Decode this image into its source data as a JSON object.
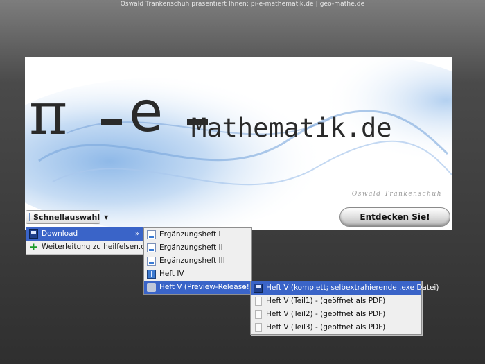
{
  "header": {
    "text": "Oswald Tränkenschuh präsentiert Ihnen: pi-e-mathematik.de | geo-mathe.de"
  },
  "banner": {
    "logo_pi": "π",
    "logo_e": "e",
    "logo_word": "Mathematik.de",
    "signature": "Oswald Tränkenschuh"
  },
  "toolbar": {
    "quick_select_label": "Schnellauswahl",
    "discover_label": "Entdecken Sie!"
  },
  "menu_main": {
    "items": [
      {
        "label": "Download",
        "icon": "floppy-icon",
        "submenu": true
      },
      {
        "label": "Weiterleitung zu heilfelsen.de",
        "icon": "plus-icon",
        "submenu": false
      }
    ]
  },
  "menu_download": {
    "items": [
      {
        "label": "Ergänzungsheft I",
        "icon": "page-icon"
      },
      {
        "label": "Ergänzungsheft II",
        "icon": "page-icon"
      },
      {
        "label": "Ergänzungsheft III",
        "icon": "page-icon"
      },
      {
        "label": "Heft IV",
        "icon": "book-icon"
      },
      {
        "label": "Heft V (Preview-Release!)",
        "icon": "download-icon",
        "submenu": true
      }
    ]
  },
  "menu_heft5": {
    "items": [
      {
        "label": "Heft V (komplett; selbextrahierende .exe Datei)",
        "icon": "floppy-icon"
      },
      {
        "label": "Heft V (Teil1) - (geöffnet als PDF)",
        "icon": "blank-page-icon"
      },
      {
        "label": "Heft V (Teil2) - (geöffnet als PDF)",
        "icon": "blank-page-icon"
      },
      {
        "label": "Heft V (Teil3) - (geöffnet als PDF)",
        "icon": "blank-page-icon"
      }
    ]
  },
  "submenu_arrow": "»",
  "colors": {
    "highlight": "#3a64c8",
    "menu_bg": "#efefef"
  }
}
